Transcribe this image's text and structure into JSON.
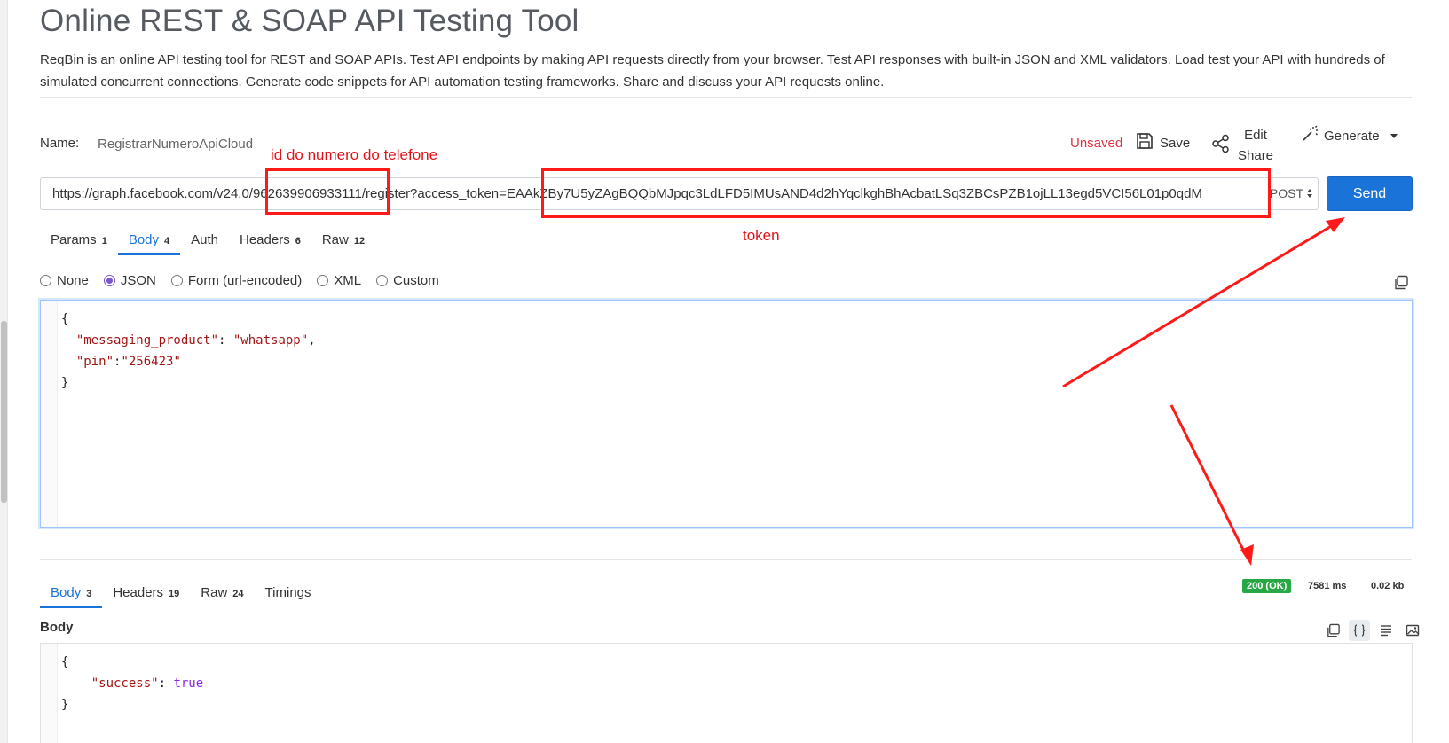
{
  "page": {
    "title": "Online REST & SOAP API Testing Tool",
    "intro": "ReqBin is an online API testing tool for REST and SOAP APIs. Test API endpoints by making API requests directly from your browser. Test API responses with built-in JSON and XML validators. Load test your API with hundreds of simulated concurrent connections. Generate code snippets for API automation testing frameworks. Share and discuss your API requests online."
  },
  "request": {
    "name_label": "Name:",
    "name_value": "RegistrarNumeroApiCloud",
    "unsaved_label": "Unsaved",
    "save_label": "Save",
    "edit_label": "Edit",
    "share_label": "Share",
    "generate_label": "Generate",
    "url": "https://graph.facebook.com/v24.0/962639906933111/register?access_token=EAAkZBy7U5yZAgBQQbMJpqc3LdLFD5IMUsAND4d2hYqclkghBhAcbatLSq3ZBCsPZB1ojLL13egd5VCI56L01p0qdM",
    "method": "POST",
    "send_label": "Send",
    "tabs": [
      {
        "label": "Params",
        "count": "1"
      },
      {
        "label": "Body",
        "count": "4"
      },
      {
        "label": "Auth",
        "count": ""
      },
      {
        "label": "Headers",
        "count": "6"
      },
      {
        "label": "Raw",
        "count": "12"
      }
    ],
    "body_types": [
      "None",
      "JSON",
      "Form (url-encoded)",
      "XML",
      "Custom"
    ],
    "body_code": {
      "open": "{",
      "line1_key": "\"messaging_product\"",
      "line1_sep": ": ",
      "line1_val": "\"whatsapp\"",
      "line1_end": ",",
      "line2_key": "\"pin\"",
      "line2_sep": ":",
      "line2_val": "\"256423\"",
      "close": "}"
    }
  },
  "response": {
    "tabs": [
      {
        "label": "Body",
        "count": "3"
      },
      {
        "label": "Headers",
        "count": "19"
      },
      {
        "label": "Raw",
        "count": "24"
      },
      {
        "label": "Timings",
        "count": ""
      }
    ],
    "status": "200 (OK)",
    "time": "7581 ms",
    "size": "0.02 kb",
    "body_heading": "Body",
    "body_code": {
      "open": "{",
      "key": "\"success\"",
      "sep": ": ",
      "val": "true",
      "close": "}"
    }
  },
  "annotations": {
    "phone_id_label": "id do numero do telefone",
    "token_label": "token",
    "color": "#ff1a1a"
  },
  "colors": {
    "accent": "#1a73d9",
    "success": "#28a745",
    "danger": "#dc3545"
  }
}
